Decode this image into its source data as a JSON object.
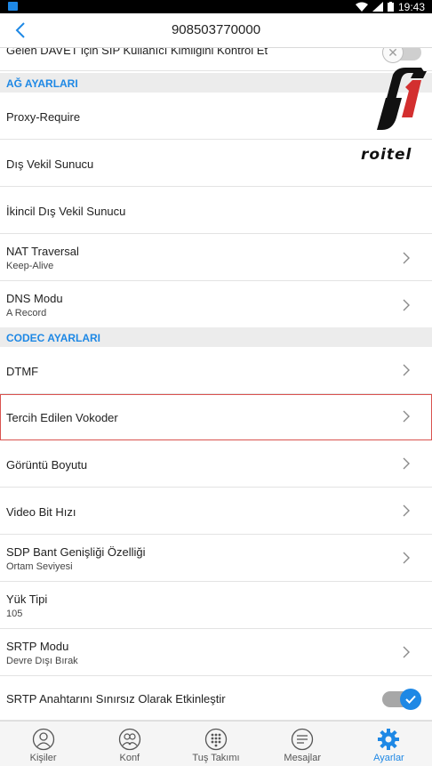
{
  "status_bar": {
    "time": "19:43"
  },
  "header": {
    "title": "908503770000"
  },
  "rows_top": {
    "partial_label": "Gelen DAVET için SIP Kullanıcı Kimliğini Kontrol Et"
  },
  "section_network": "AĞ AYARLARI",
  "network": {
    "proxy_require": "Proxy-Require",
    "outbound_proxy": "Dış Vekil Sunucu",
    "secondary_proxy": "İkincil Dış Vekil Sunucu",
    "nat_label": "NAT Traversal",
    "nat_value": "Keep-Alive",
    "dns_label": "DNS Modu",
    "dns_value": "A Record"
  },
  "section_codec": "CODEC AYARLARI",
  "codec": {
    "dtmf": "DTMF",
    "vocoder": "Tercih Edilen Vokoder",
    "video_size": "Görüntü Boyutu",
    "video_bitrate": "Video Bit Hızı",
    "sdp_label": "SDP Bant Genişliği Özelliği",
    "sdp_value": "Ortam Seviyesi",
    "payload_label": "Yük Tipi",
    "payload_value": "105",
    "srtp_label": "SRTP Modu",
    "srtp_value": "Devre Dışı Bırak",
    "srtp_unlimited": "SRTP Anahtarını Sınırsız Olarak Etkinleştir"
  },
  "logo": {
    "brand_text": "roitel"
  },
  "nav": {
    "contacts": "Kişiler",
    "conference": "Konf",
    "keypad": "Tuş Takımı",
    "messages": "Mesajlar",
    "settings": "Ayarlar"
  },
  "colors": {
    "accent": "#1e88e5",
    "highlight_border": "#d9534f",
    "section_bg": "#ececec"
  },
  "toggles": {
    "check_sip_user_id": false,
    "srtp_unlimited": true
  },
  "active_tab": "settings"
}
